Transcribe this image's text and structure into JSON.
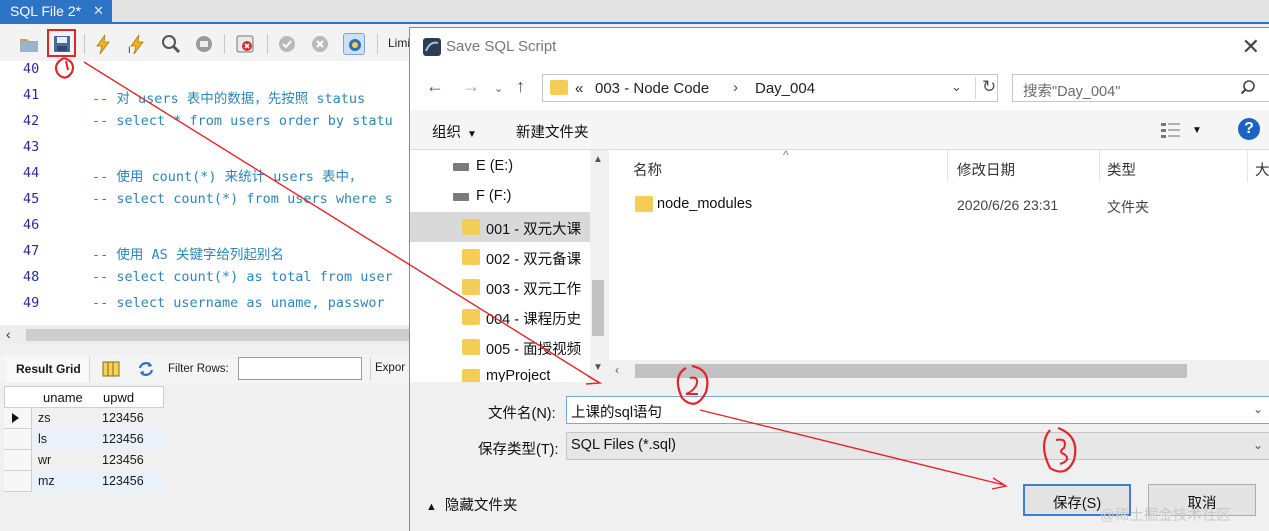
{
  "editor_tab": {
    "title": "SQL File 2*"
  },
  "toolbar": {
    "limit_label": "Limi"
  },
  "editor": {
    "lines": [
      {
        "num": "40",
        "text": ""
      },
      {
        "num": "41",
        "text": "-- 对 users 表中的数据，先按照 status"
      },
      {
        "num": "42",
        "text": "-- select * from users order by statu"
      },
      {
        "num": "43",
        "text": ""
      },
      {
        "num": "44",
        "text": "-- 使用 count(*) 来统计 users 表中，"
      },
      {
        "num": "45",
        "text": "-- select count(*) from users where s"
      },
      {
        "num": "46",
        "text": ""
      },
      {
        "num": "47",
        "text": "-- 使用 AS 关键字给列起别名"
      },
      {
        "num": "48",
        "text": "-- select count(*) as total from user"
      },
      {
        "num": "49",
        "text": "-- select username as uname, passwor"
      }
    ]
  },
  "result_panel": {
    "tab_label": "Result Grid",
    "filter_label": "Filter Rows:",
    "filter_value": "",
    "export_label": "Expor",
    "columns": [
      "uname",
      "upwd"
    ],
    "rows": [
      {
        "uname": "zs",
        "upwd": "123456"
      },
      {
        "uname": "ls",
        "upwd": "123456"
      },
      {
        "uname": "wr",
        "upwd": "123456"
      },
      {
        "uname": "mz",
        "upwd": "123456"
      }
    ]
  },
  "dialog": {
    "title": "Save SQL Script",
    "breadcrumb": [
      "«",
      "003 - Node Code",
      "Day_004"
    ],
    "search_placeholder": "搜索\"Day_004\"",
    "organize_label": "组织",
    "new_folder_label": "新建文件夹",
    "help_label": "?",
    "tree": [
      {
        "label": "E (E:)",
        "kind": "drive"
      },
      {
        "label": "F (F:)",
        "kind": "drive"
      },
      {
        "label": "001 - 双元大课",
        "kind": "folder",
        "selected": true
      },
      {
        "label": "002 - 双元备课",
        "kind": "folder"
      },
      {
        "label": "003 - 双元工作",
        "kind": "folder"
      },
      {
        "label": "004 - 课程历史",
        "kind": "folder"
      },
      {
        "label": "005 - 面授视频",
        "kind": "folder"
      },
      {
        "label": "myProject",
        "kind": "folder"
      }
    ],
    "columns": {
      "name": "名称",
      "modified": "修改日期",
      "type": "类型",
      "size": "大"
    },
    "files": [
      {
        "name": "node_modules",
        "modified": "2020/6/26 23:31",
        "type": "文件夹"
      }
    ],
    "filename_label": "文件名(N):",
    "filename_value": "上课的sql语句",
    "filetype_label": "保存类型(T):",
    "filetype_value": "SQL Files (*.sql)",
    "hide_folders_label": "隐藏文件夹",
    "save_button": "保存(S)",
    "cancel_button": "取消"
  },
  "watermark": "@稀土掘金技术社区",
  "accent_colors": {
    "tab": "#2d73c6",
    "annotation": "#e0262a",
    "comment": "#2b86b7"
  }
}
